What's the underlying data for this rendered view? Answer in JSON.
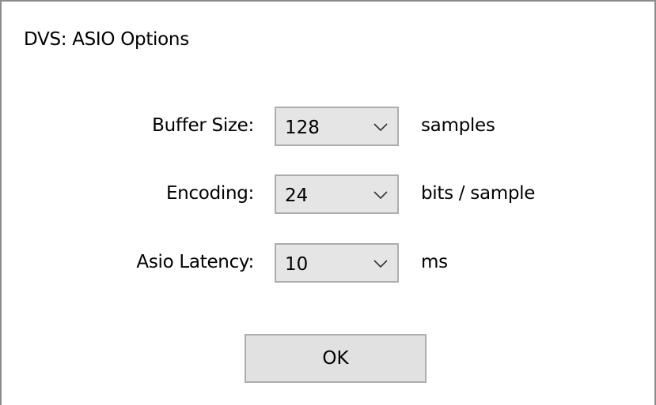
{
  "window": {
    "title": "DVS: ASIO Options"
  },
  "options": [
    {
      "label": "Buffer Size:",
      "value": "128",
      "unit": "samples"
    },
    {
      "label": "Encoding:",
      "value": "24",
      "unit": "bits / sample"
    },
    {
      "label": "Asio Latency:",
      "value": "10",
      "unit": "ms"
    }
  ],
  "buttons": {
    "ok_label": "OK"
  },
  "icons": {
    "dropdown": "chevron-down-icon"
  },
  "colors": {
    "combo_background": "#e5e5e5",
    "combo_border": "#adadad",
    "button_background": "#e1e1e1",
    "window_border": "#8c8c8c"
  }
}
